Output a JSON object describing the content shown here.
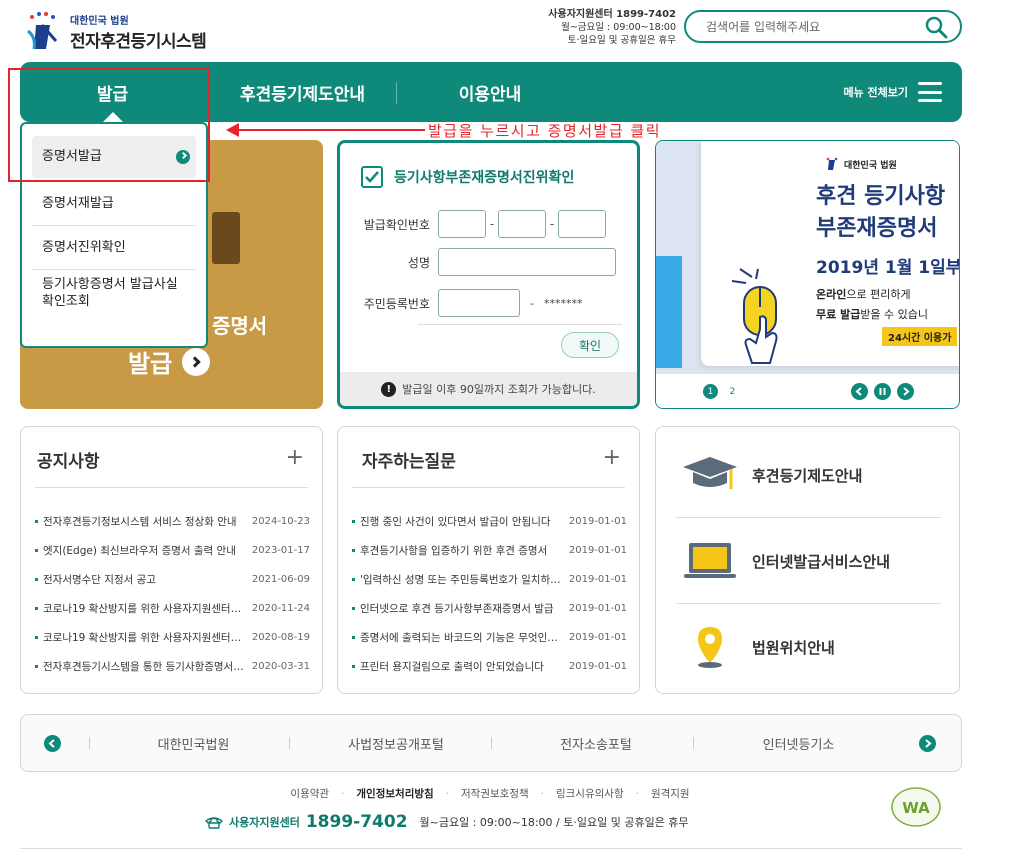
{
  "header": {
    "org": "대한민국 법원",
    "title": "전자후견등기시스템",
    "support_line1": "사용자지원센터 1899-7402",
    "support_line2": "월~금요일 : 09:00~18:00",
    "support_line3": "토·일요일 및 공휴일은 휴무",
    "search_placeholder": "검색어를 입력해주세요"
  },
  "nav": {
    "items": [
      "발급",
      "후견등기제도안내",
      "이용안내"
    ],
    "all_menu": "메뉴 전체보기"
  },
  "dropdown": {
    "items": [
      "증명서발급",
      "증명서재발급",
      "증명서진위확인",
      "등기사항증명서 발급사실",
      "확인조회"
    ]
  },
  "annotation": "발급을 누르시고 증명서발급 클릭",
  "gold_card": {
    "line1": "증명서",
    "line2": "발급"
  },
  "verify": {
    "title": "등기사항부존재증명서진위확인",
    "label_number": "발급확인번호",
    "label_name": "성명",
    "label_rrn": "주민등록번호",
    "dash": "-",
    "masked": "*******",
    "button": "확인",
    "info": "발급일 이후 90일까지 조회가 가능합니다."
  },
  "banner": {
    "org": "대한민국 법원",
    "headline1": "후견 등기사항",
    "headline2": "부존재증명서",
    "date": "2019년 1월 1일부",
    "line1_bold": "온라인",
    "line1_rest": "으로 편리하게",
    "line2_bold": "무료 발급",
    "line2_rest": "받을 수 있습니",
    "badge": "24시간 이용가",
    "pages": [
      "1",
      "2"
    ]
  },
  "notice": {
    "title": "공지사항",
    "plus": "+",
    "rows": [
      {
        "title": "전자후견등기정보시스템 서비스 정상화 안내",
        "date": "2024-10-23"
      },
      {
        "title": "엣지(Edge) 최신브라우저 증명서 출력 안내",
        "date": "2023-01-17"
      },
      {
        "title": "전자서명수단 지정서 공고",
        "date": "2021-06-09"
      },
      {
        "title": "코로나19 확산방지를 위한 사용자지원센터 운영 안내",
        "date": "2020-11-24"
      },
      {
        "title": "코로나19 확산방지를 위한 사용자지원센터 운영 안내",
        "date": "2020-08-19"
      },
      {
        "title": "전자후견등기시스템을 통한 등기사항증명서 발급 안내",
        "date": "2020-03-31"
      }
    ]
  },
  "faq": {
    "title": "자주하는질문",
    "plus": "+",
    "rows": [
      {
        "title": "진행 중인 사건이 있다면서 발급이 안됩니다",
        "date": "2019-01-01"
      },
      {
        "title": "후견등기사항을 입증하기 위한 후견 증명서",
        "date": "2019-01-01"
      },
      {
        "title": "'입력하신 성명 또는 주민등록번호가 일치하지 않습니다'",
        "date": "2019-01-01"
      },
      {
        "title": "인터넷으로 후견 등기사항부존재증명서 발급",
        "date": "2019-01-01"
      },
      {
        "title": "증명서에 출력되는 바코드의 기능은 무엇인가요",
        "date": "2019-01-01"
      },
      {
        "title": "프린터 용지걸림으로 출력이 안되었습니다",
        "date": "2019-01-01"
      }
    ]
  },
  "quick": [
    {
      "label": "후견등기제도안내",
      "icon": "graduation-cap-icon"
    },
    {
      "label": "인터넷발급서비스안내",
      "icon": "laptop-icon"
    },
    {
      "label": "법원위치안내",
      "icon": "location-pin-icon"
    }
  ],
  "related": [
    "대한민국법원",
    "사법정보공개포털",
    "전자소송포털",
    "인터넷등기소"
  ],
  "footer": {
    "links": [
      "이용약관",
      "개인정보처리방침",
      "저작권보호정책",
      "링크시유의사항",
      "원격지원"
    ],
    "support_label": "사용자지원센터",
    "support_number": "1899-7402",
    "hours": "월~금요일 : 09:00~18:00 / 토·일요일 및 공휴일은 휴무"
  },
  "colors": {
    "primary": "#0f8a7a",
    "annotation": "#e3242b",
    "gold": "#c99a45"
  }
}
